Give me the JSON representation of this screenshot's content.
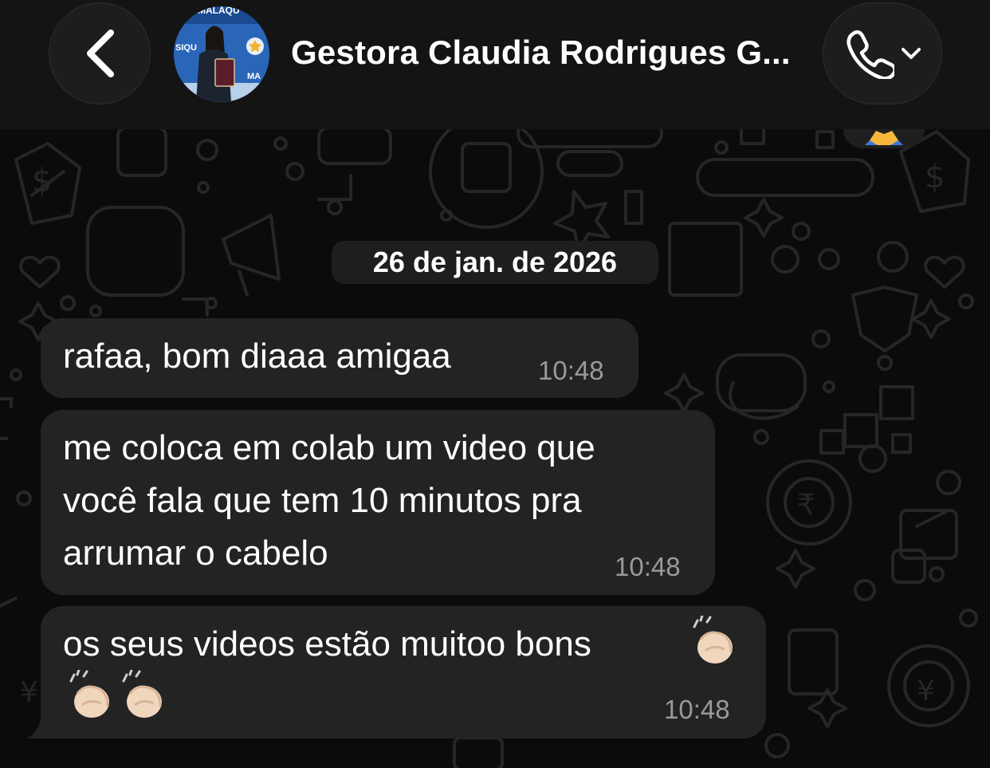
{
  "header": {
    "back_icon": "chevron-left-icon",
    "contact_name": "Gestora Claudia Rodrigues G...",
    "avatar_text_top": "MALAQU",
    "avatar_text_left": "SIQU",
    "avatar_text_right": "MA",
    "call_icon": "phone-icon",
    "call_dropdown_icon": "chevron-down-icon"
  },
  "peek_reaction": "pray-emoji",
  "date_separator": "26 de jan. de 2026",
  "messages": [
    {
      "text": "rafaa, bom diaaa amigaa",
      "time": "10:48"
    },
    {
      "lines": [
        "me coloca em colab um video que",
        "você fala que tem 10 minutos pra",
        "arrumar o cabelo"
      ],
      "time": "10:48"
    },
    {
      "text": "os seus videos estão muitoo bons",
      "emoji": "clapping-hands-emoji",
      "time": "10:48"
    }
  ],
  "colors": {
    "background": "#0b0b0b",
    "header": "#141414",
    "bubble": "#232323",
    "time": "#9a9a9a"
  }
}
